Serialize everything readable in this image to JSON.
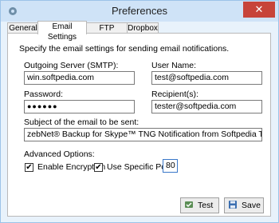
{
  "window": {
    "title": "Preferences"
  },
  "tabs": [
    {
      "label": "General"
    },
    {
      "label": "Email Settings"
    },
    {
      "label": "FTP Settings"
    },
    {
      "label": "Dropbox"
    }
  ],
  "panel": {
    "intro": "Specify the email settings for sending email notifications.",
    "smtp": {
      "label": "Outgoing Server (SMTP):",
      "value": "win.softpedia.com"
    },
    "username": {
      "label": "User Name:",
      "value": "test@softpedia.com"
    },
    "password": {
      "label": "Password:",
      "value": "●●●●●●"
    },
    "recipients": {
      "label": "Recipient(s):",
      "value": "tester@softpedia.com"
    },
    "subject": {
      "label": "Subject of the email to be sent:",
      "value": "zebNet® Backup for Skype™ TNG Notification from Softpedia Test"
    },
    "advanced": {
      "label": "Advanced Options:",
      "encryption": {
        "label": "Enable Encryption",
        "checked": true
      },
      "specific_port": {
        "label": "Use Specific Port",
        "checked": true
      },
      "port": "80"
    },
    "check_mark": "✔"
  },
  "buttons": {
    "test": "Test",
    "save": "Save"
  },
  "icons": {
    "app": "gear-icon",
    "close": "close-icon",
    "test": "test-icon",
    "save": "save-icon"
  },
  "colors": {
    "accent": "#cfe3f7",
    "close": "#c7443a"
  }
}
